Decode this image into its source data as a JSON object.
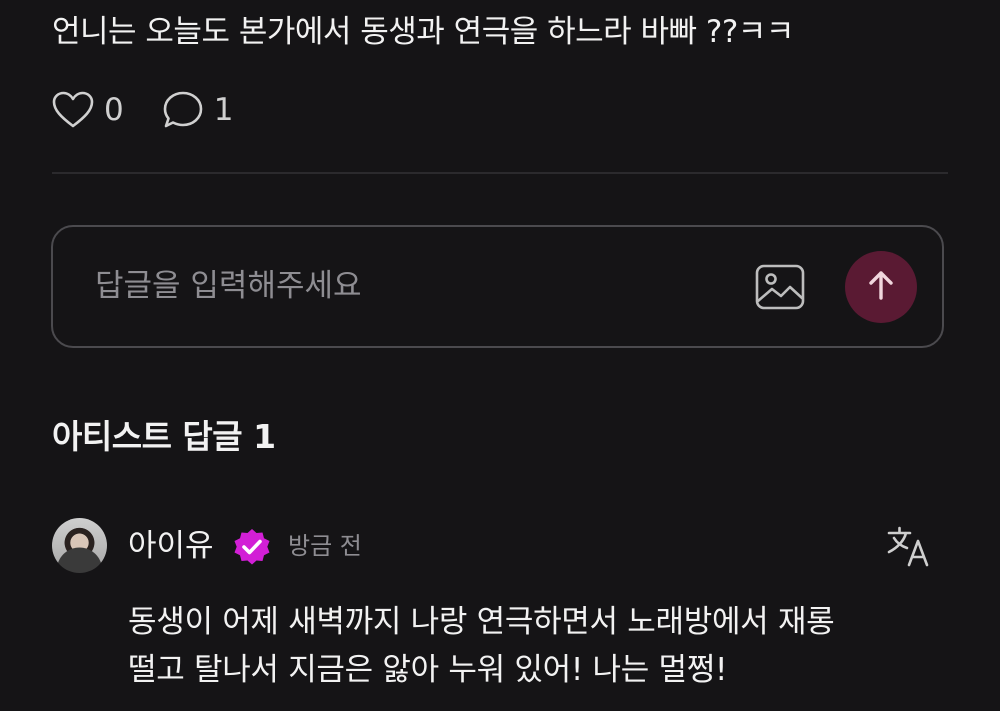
{
  "post": {
    "text": "언니는 오늘도 본가에서 동생과 연극을 하느라 바빠 ??ㅋㅋ",
    "likes": "0",
    "comments": "1",
    "like_icon": "heart-icon",
    "comment_icon": "speech-bubble-icon"
  },
  "reply": {
    "placeholder": "답글을 입력해주세요",
    "value": "",
    "image_icon": "image-icon",
    "send_icon": "arrow-up-icon"
  },
  "artist_replies": {
    "title": "아티스트 답글 1"
  },
  "comment": {
    "author": "아이유",
    "timestamp": "방금 전",
    "body_line1": "동생이 어제 새벽까지 나랑 연극하면서 노래방에서 재롱",
    "body_line2": "떨고 탈나서 지금은 앓아 누워 있어! 나는 멀쩡!",
    "verified_icon": "verified-badge-icon",
    "translate_icon": "translate-icon"
  },
  "colors": {
    "background": "#151416",
    "text": "#f2f2f2",
    "muted": "#8e8d92",
    "send_button": "#5a1a33",
    "verified_badge": "#d21fd6",
    "border": "#4b4a4e"
  }
}
